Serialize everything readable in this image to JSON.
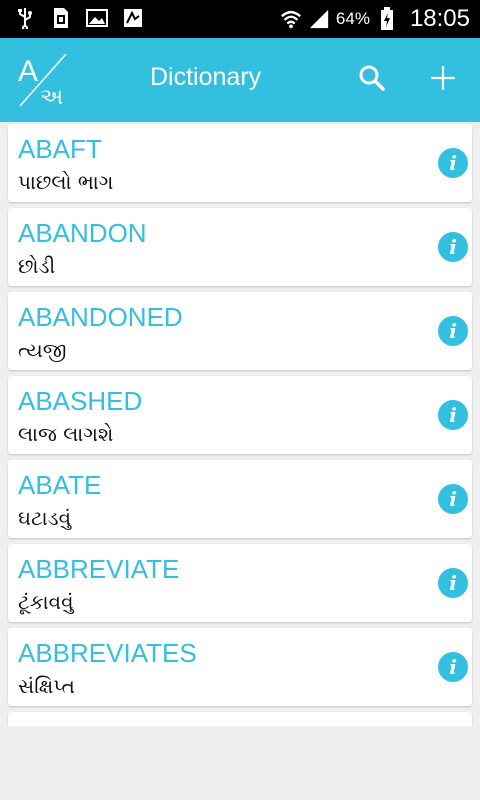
{
  "status_bar": {
    "battery_percent": "64%",
    "time": "18:05",
    "icons": [
      "usb-icon",
      "sim-icon",
      "gallery-icon",
      "notification-icon",
      "wifi-icon",
      "signal-icon",
      "battery-charging-icon"
    ]
  },
  "app_bar": {
    "logo_letters": {
      "latin": "A",
      "gujarati": "અ"
    },
    "title": "Dictionary",
    "actions": [
      "search-icon",
      "add-icon"
    ]
  },
  "colors": {
    "accent": "#33bfe0",
    "background": "#efefef",
    "card": "#ffffff",
    "status_bar": "#000000"
  },
  "words": [
    {
      "word": "ABAFT",
      "meaning": "પાછલો ભાગ"
    },
    {
      "word": "ABANDON",
      "meaning": "છોડી"
    },
    {
      "word": "ABANDONED",
      "meaning": "ત્યજી"
    },
    {
      "word": "ABASHED",
      "meaning": "લાજ લાગશે"
    },
    {
      "word": "ABATE",
      "meaning": "ઘટાડવું"
    },
    {
      "word": "ABBREVIATE",
      "meaning": "ટૂંકાવવું"
    },
    {
      "word": "ABBREVIATES",
      "meaning": "સંક્ષિપ્ત"
    }
  ]
}
